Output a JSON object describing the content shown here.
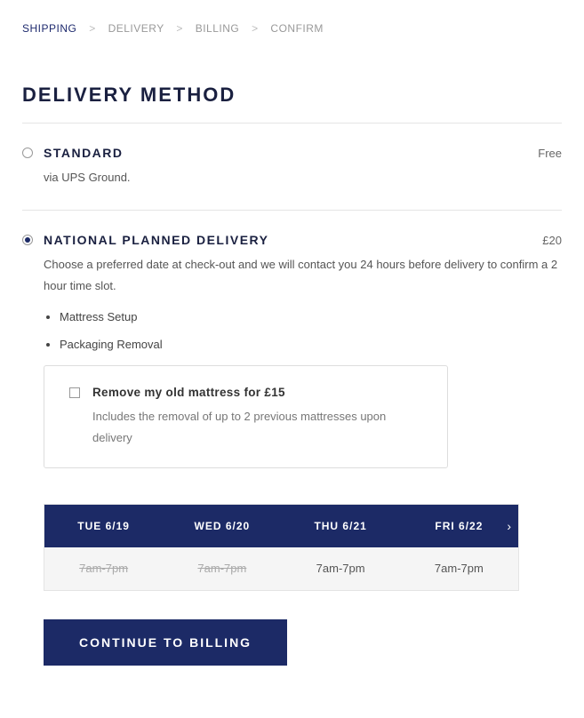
{
  "breadcrumb": {
    "steps": [
      "SHIPPING",
      "DELIVERY",
      "BILLING",
      "CONFIRM"
    ],
    "active_index": 0
  },
  "page_title": "DELIVERY METHOD",
  "options": {
    "standard": {
      "title": "STANDARD",
      "price": "Free",
      "desc": "via UPS Ground.",
      "selected": false
    },
    "national": {
      "title": "NATIONAL PLANNED DELIVERY",
      "price": "£20",
      "desc": "Choose a preferred date at check-out and we will contact you 24 hours before delivery to confirm a 2 hour time slot.",
      "selected": true,
      "features": [
        "Mattress Setup",
        "Packaging Removal"
      ],
      "addon": {
        "title": "Remove my old mattress for £15",
        "desc": "Includes the removal of up to 2 previous mattresses upon delivery",
        "checked": false
      }
    }
  },
  "date_picker": {
    "dates": [
      {
        "label": "TUE 6/19",
        "slot": "7am-7pm",
        "available": false
      },
      {
        "label": "WED 6/20",
        "slot": "7am-7pm",
        "available": false
      },
      {
        "label": "THU 6/21",
        "slot": "7am-7pm",
        "available": true
      },
      {
        "label": "FRI 6/22",
        "slot": "7am-7pm",
        "available": true
      }
    ]
  },
  "cta": "CONTINUE TO BILLING"
}
